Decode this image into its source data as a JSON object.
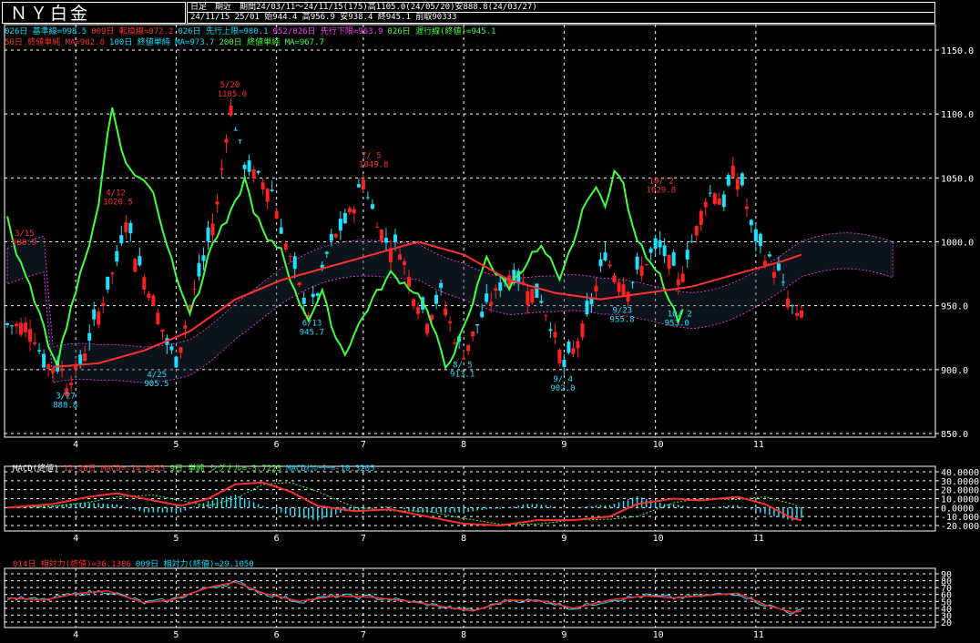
{
  "title": "ＮＹ白金",
  "header": {
    "line1": "日足　期近　期間24/03/11～24/11/15(175)高1105.0(24/05/20)安888.8(24/03/27)",
    "line2": "24/11/15 25/01 始944.4 高956.9 安938.4 終945.1 前取90333"
  },
  "legend_main": [
    {
      "text": "026日 基準線=998.5",
      "color": "#00e0ff"
    },
    {
      "text": "009日 転換線=972.2",
      "color": "#ff3030"
    },
    {
      "text": "026日 先行上限=980.1",
      "color": "#00e0ff"
    },
    {
      "text": "052/026日 先行下限=963.9",
      "color": "#ff40ff"
    },
    {
      "text": "026日 遅行線(終値)=945.1",
      "color": "#40ff40"
    }
  ],
  "legend_main2": [
    {
      "text": "50日 終値単純 MA=982.8",
      "color": "#ff3030"
    },
    {
      "text": "100日 終値単純 MA=973.7",
      "color": "#00e0ff"
    },
    {
      "text": "200日 終値単純 MA=967.7",
      "color": "#40ff40"
    }
  ],
  "legend_macd": [
    {
      "text": "MACD(終値)",
      "color": "#ffffff"
    },
    {
      "text": "12-26日 MACD=-14.0423",
      "color": "#ff3030"
    },
    {
      "text": "9日 単純 シグナル=-3.7223",
      "color": "#40ff40"
    },
    {
      "text": "MACDｵｼﾚｰﾀｰ=-10.3205",
      "color": "#00e0ff"
    }
  ],
  "legend_rsi": [
    {
      "text": "014日 相対力(終値)=36.1386",
      "color": "#ff3030"
    },
    {
      "text": "009日 相対力(終値)=29.1050",
      "color": "#00e0ff"
    }
  ],
  "colors": {
    "up": "#ff2020",
    "down": "#20e0ff",
    "grid": "#ffffff",
    "axis": "#ffffff",
    "annot_high": "#ff3030",
    "annot_low": "#20e0ff"
  },
  "chart_data": [
    {
      "type": "candlestick",
      "name": "price",
      "ylim": [
        850,
        1150
      ],
      "yticks": [
        850,
        900,
        950,
        1000,
        1050,
        1100,
        1150
      ],
      "ytick_labels": [
        "850.0",
        "900.0",
        "950.0",
        "1000.0",
        "1050.0",
        "1100.0",
        "1150.0"
      ],
      "xticks": [
        {
          "label": "4",
          "day": 15
        },
        {
          "label": "5",
          "day": 37
        },
        {
          "label": "6",
          "day": 59
        },
        {
          "label": "7",
          "day": 78
        },
        {
          "label": "8",
          "day": 100
        },
        {
          "label": "9",
          "day": 122
        },
        {
          "label": "10",
          "day": 142
        },
        {
          "label": "11",
          "day": 164
        }
      ],
      "n_days": 175,
      "close_path": [
        [
          0,
          935
        ],
        [
          5,
          935
        ],
        [
          8,
          905
        ],
        [
          12,
          900
        ],
        [
          13,
          889
        ],
        [
          16,
          905
        ],
        [
          20,
          945
        ],
        [
          24,
          985
        ],
        [
          26,
          1020
        ],
        [
          28,
          990
        ],
        [
          32,
          955
        ],
        [
          35,
          920
        ],
        [
          37,
          906
        ],
        [
          40,
          950
        ],
        [
          43,
          985
        ],
        [
          46,
          1030
        ],
        [
          48,
          1085
        ],
        [
          49,
          1105
        ],
        [
          52,
          1060
        ],
        [
          55,
          1050
        ],
        [
          58,
          1040
        ],
        [
          60,
          1010
        ],
        [
          63,
          975
        ],
        [
          66,
          945
        ],
        [
          68,
          960
        ],
        [
          70,
          990
        ],
        [
          72,
          1005
        ],
        [
          74,
          1015
        ],
        [
          76,
          1030
        ],
        [
          78,
          1049
        ],
        [
          80,
          1025
        ],
        [
          83,
          1000
        ],
        [
          86,
          995
        ],
        [
          89,
          960
        ],
        [
          92,
          940
        ],
        [
          95,
          960
        ],
        [
          98,
          925
        ],
        [
          100,
          913
        ],
        [
          103,
          935
        ],
        [
          106,
          955
        ],
        [
          110,
          975
        ],
        [
          114,
          965
        ],
        [
          117,
          955
        ],
        [
          120,
          925
        ],
        [
          122,
          902
        ],
        [
          124,
          915
        ],
        [
          127,
          940
        ],
        [
          129,
          965
        ],
        [
          131,
          990
        ],
        [
          133,
          975
        ],
        [
          136,
          965
        ],
        [
          139,
          980
        ],
        [
          141,
          990
        ],
        [
          143,
          995
        ],
        [
          145,
          985
        ],
        [
          147,
          968
        ],
        [
          149,
          990
        ],
        [
          151,
          1010
        ],
        [
          153,
          1035
        ],
        [
          155,
          1040
        ],
        [
          157,
          1030
        ],
        [
          159,
          1055
        ],
        [
          161,
          1045
        ],
        [
          163,
          1010
        ],
        [
          165,
          995
        ],
        [
          167,
          985
        ],
        [
          169,
          975
        ],
        [
          171,
          955
        ],
        [
          173,
          940
        ],
        [
          174,
          945
        ]
      ],
      "annotations": [
        {
          "label": "3/15",
          "value_label": "988.9",
          "day": 4,
          "value": 988.9,
          "kind": "high"
        },
        {
          "label": "3/27",
          "value_label": "888.8",
          "day": 13,
          "value": 888.8,
          "kind": "low"
        },
        {
          "label": "4/12",
          "value_label": "1020.5",
          "day": 24,
          "value": 1020.5,
          "kind": "high"
        },
        {
          "label": "4/25",
          "value_label": "905.5",
          "day": 33,
          "value": 905.5,
          "kind": "low"
        },
        {
          "label": "5/20",
          "value_label": "1105.0",
          "day": 49,
          "value": 1105.0,
          "kind": "high"
        },
        {
          "label": "6/13",
          "value_label": "945.7",
          "day": 67,
          "value": 945.7,
          "kind": "low"
        },
        {
          "label": "7/ 5",
          "value_label": "1049.8",
          "day": 80,
          "value": 1049.8,
          "kind": "high"
        },
        {
          "label": "8/ 5",
          "value_label": "913.1",
          "day": 100,
          "value": 913.1,
          "kind": "low"
        },
        {
          "label": "9/ 4",
          "value_label": "902.0",
          "day": 122,
          "value": 902.0,
          "kind": "low"
        },
        {
          "label": "9/23",
          "value_label": "955.8",
          "day": 135,
          "value": 955.8,
          "kind": "low"
        },
        {
          "label": "10/ 2",
          "value_label": "953.0",
          "day": 147,
          "value": 953.0,
          "kind": "low"
        },
        {
          "label": "10/ 2",
          "value_label": "1029.8",
          "day": 143,
          "value": 1029.8,
          "kind": "high"
        }
      ],
      "ma50": [
        [
          10,
          902
        ],
        [
          20,
          905
        ],
        [
          30,
          915
        ],
        [
          40,
          930
        ],
        [
          50,
          955
        ],
        [
          60,
          970
        ],
        [
          70,
          980
        ],
        [
          80,
          990
        ],
        [
          90,
          1000
        ],
        [
          100,
          990
        ],
        [
          110,
          970
        ],
        [
          120,
          960
        ],
        [
          130,
          955
        ],
        [
          140,
          960
        ],
        [
          150,
          965
        ],
        [
          160,
          975
        ],
        [
          170,
          985
        ],
        [
          174,
          990
        ]
      ]
    },
    {
      "type": "macd",
      "name": "macd",
      "ylim": [
        -20,
        40
      ],
      "yticks": [
        -20,
        -10,
        0,
        10,
        20,
        30,
        40
      ],
      "ytick_labels": [
        "-20.0000",
        "-10.0000",
        "0.0000",
        "10.0000",
        "20.0000",
        "30.0000",
        "40.0000"
      ],
      "macd_path": [
        [
          0,
          0
        ],
        [
          10,
          4
        ],
        [
          18,
          12
        ],
        [
          24,
          16
        ],
        [
          32,
          8
        ],
        [
          38,
          2
        ],
        [
          44,
          10
        ],
        [
          50,
          26
        ],
        [
          56,
          28
        ],
        [
          62,
          18
        ],
        [
          68,
          2
        ],
        [
          76,
          -4
        ],
        [
          84,
          -2
        ],
        [
          92,
          -10
        ],
        [
          100,
          -18
        ],
        [
          108,
          -20
        ],
        [
          116,
          -14
        ],
        [
          124,
          -14
        ],
        [
          132,
          -10
        ],
        [
          138,
          4
        ],
        [
          146,
          10
        ],
        [
          152,
          8
        ],
        [
          160,
          12
        ],
        [
          166,
          4
        ],
        [
          172,
          -12
        ],
        [
          174,
          -14
        ]
      ]
    },
    {
      "type": "rsi",
      "name": "rsi",
      "ylim": [
        20,
        90
      ],
      "yticks": [
        20,
        30,
        40,
        50,
        60,
        70,
        80,
        90
      ],
      "ytick_labels": [
        "20",
        "30",
        "40",
        "50",
        "60",
        "70",
        "80",
        "90"
      ],
      "rsi_path": [
        [
          0,
          55
        ],
        [
          8,
          52
        ],
        [
          16,
          62
        ],
        [
          22,
          65
        ],
        [
          30,
          48
        ],
        [
          36,
          52
        ],
        [
          44,
          70
        ],
        [
          50,
          78
        ],
        [
          56,
          62
        ],
        [
          64,
          50
        ],
        [
          72,
          58
        ],
        [
          80,
          56
        ],
        [
          88,
          50
        ],
        [
          96,
          42
        ],
        [
          102,
          36
        ],
        [
          110,
          52
        ],
        [
          118,
          50
        ],
        [
          124,
          40
        ],
        [
          132,
          52
        ],
        [
          140,
          58
        ],
        [
          146,
          55
        ],
        [
          152,
          58
        ],
        [
          160,
          62
        ],
        [
          166,
          45
        ],
        [
          172,
          34
        ],
        [
          174,
          36
        ]
      ]
    }
  ]
}
